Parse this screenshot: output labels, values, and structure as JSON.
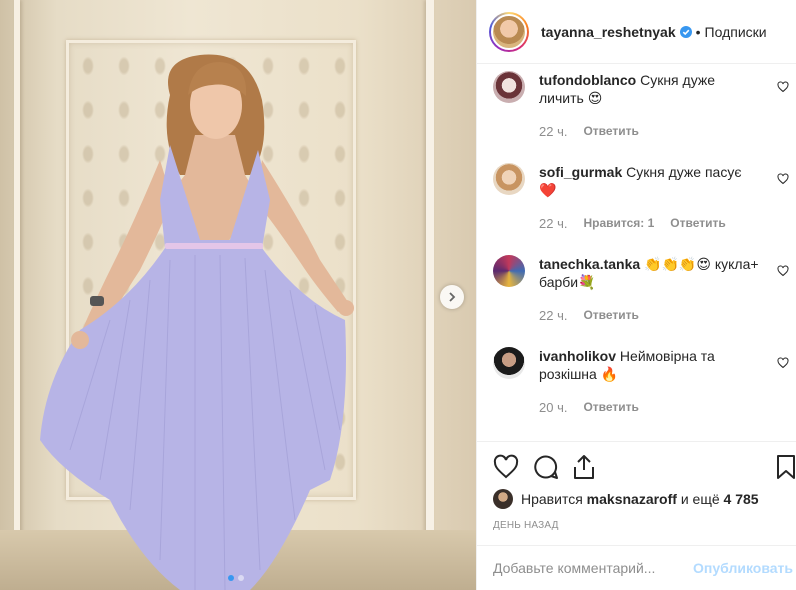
{
  "post": {
    "username": "tayanna_reshetnyak",
    "follow_label": "Подписки",
    "follow_sep": "•"
  },
  "comments": [
    {
      "user": "tufondoblanco",
      "text": "Сукня дуже личить 😍",
      "ago": "22 ч.",
      "likes": "",
      "reply": "Ответить"
    },
    {
      "user": "sofi_gurmak",
      "text": "Сукня дуже пасує ❤️",
      "ago": "22 ч.",
      "likes": "Нравится: 1",
      "reply": "Ответить"
    },
    {
      "user": "tanechka.tanka",
      "text": "👏👏👏😍 кукла+ барби💐",
      "ago": "22 ч.",
      "likes": "",
      "reply": "Ответить"
    },
    {
      "user": "ivanholikov",
      "text": "Неймовірна та розкішна 🔥",
      "ago": "20 ч.",
      "likes": "",
      "reply": "Ответить"
    }
  ],
  "likes": {
    "prefix": "Нравится",
    "user": "maksnazaroff",
    "middle": "и ещё",
    "count": "4 785"
  },
  "time_ago": "ДЕНЬ НАЗАД",
  "add_comment": {
    "placeholder": "Добавьте комментарий...",
    "publish": "Опубликовать"
  },
  "colors": {
    "accent": "#3897f0",
    "publish_disabled": "#b3dbff",
    "dress": "#b7b4e6"
  },
  "icons": [
    "verified-icon",
    "chevron-right-icon",
    "heart-icon",
    "comment-icon",
    "share-icon",
    "bookmark-icon"
  ]
}
